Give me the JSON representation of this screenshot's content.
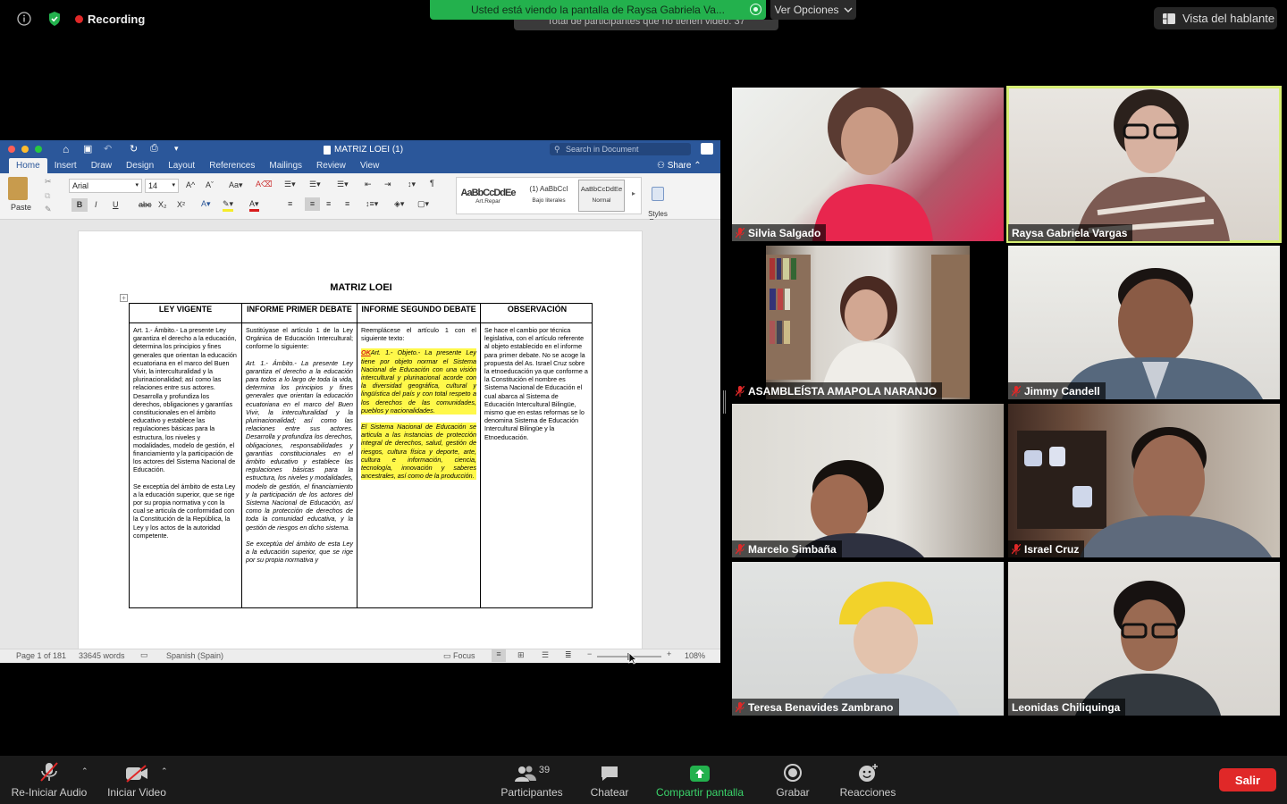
{
  "top": {
    "recording_label": "Recording",
    "share_banner": "Usted está viendo la pantalla de Raysa Gabriela Va...",
    "view_options": "Ver Opciones",
    "ghost_tip": "Total de participantes que no tienen video: 37",
    "speaker_view": "Vista del hablante"
  },
  "word": {
    "title": "MATRIZ LOEI (1)",
    "search_placeholder": "Search in Document",
    "share": "Share",
    "tabs": [
      "Home",
      "Insert",
      "Draw",
      "Design",
      "Layout",
      "References",
      "Mailings",
      "Review",
      "View"
    ],
    "font_name": "Arial",
    "font_size": "14",
    "paste": "Paste",
    "styles": [
      {
        "preview": "AaBbCcDdEe",
        "name": "Art.Repar"
      },
      {
        "preview": "(1) AaBbCcI",
        "name": "Bajo literales"
      },
      {
        "preview": "AaBbCcDdEe",
        "name": "Normal"
      }
    ],
    "styles_pane": "Styles\nPane",
    "status": {
      "page": "Page 1 of 181",
      "words": "33645 words",
      "language": "Spanish (Spain)",
      "focus": "Focus",
      "zoom": "108%"
    },
    "doc": {
      "heading": "MATRIZ LOEI",
      "columns": [
        "LEY VIGENTE",
        "INFORME PRIMER DEBATE",
        "INFORME SEGUNDO DEBATE",
        "OBSERVACIÓN"
      ],
      "col1": "Art. 1.- Ámbito.- La presente Ley garantiza el derecho a la educación, determina los principios y fines generales que orientan la educación ecuatoriana en el marco del Buen Vivir, la interculturalidad y la plurinacionalidad; así como las relaciones entre sus actores. Desarrolla y profundiza los derechos, obligaciones y garantías constitucionales en el ámbito educativo y establece las regulaciones básicas para la estructura, los niveles y modalidades, modelo de gestión, el financiamiento y la participación de los actores del Sistema Nacional de Educación.",
      "col1b": "Se exceptúa del ámbito de esta Ley a la educación superior, que se rige por su propia normativa y con la cual se articula de conformidad con la Constitución de la República, la Ley y los actos de la autoridad competente.",
      "col2a": "Sustitúyase el artículo 1 de la Ley Orgánica de Educación Intercultural; conforme lo siguiente:",
      "col2b": "Art. 1.- Ámbito.- La presente Ley garantiza el derecho a la educación para todos a lo largo de toda la vida, determina los principios y fines generales que orientan la educación ecuatoriana en el marco del Buen Vivir, la interculturalidad y la plurinacionalidad; así como las relaciones entre sus actores. Desarrolla y profundiza los derechos, obligaciones, responsabilidades y garantías constitucionales en el ámbito educativo y establece las regulaciones básicas para la estructura, los niveles y modalidades, modelo de gestión, el financiamiento y la participación de los actores del Sistema Nacional de Educación, así como la protección de derechos de toda la comunidad educativa, y la gestión de riesgos en dicho sistema.",
      "col2c": "Se exceptúa del ámbito de esta Ley a la educación superior, que se rige por su propia normativa y",
      "col3a": "Reemplácese el artículo 1 con el siguiente texto:",
      "col3_ok": "OK",
      "col3b": "Art. 1.- Objeto.- La presente Ley tiene por objeto normar el Sistema Nacional de Educación con una visión intercultural y plurinacional acorde con la diversidad geográfica, cultural y lingüística del país y con total respeto a los derechos de las comunidades, pueblos y nacionalidades.",
      "col3c": "El Sistema Nacional de Educación se articula a las instancias de protección integral de derechos, salud, gestión de riesgos, cultura física y deporte, arte, cultura e información, ciencia, tecnología, innovación y saberes ancestrales, así como de la producción.",
      "col4": "Se hace el cambio por técnica legislativa, con el artículo referente al objeto establecido en el informe para primer debate. No se acoge la propuesta del As. Israel Cruz sobre la etnoeducación ya que conforme a la Constitución el nombre es Sistema Nacional de Educación el cual abarca al Sistema de Educación Intercultural Bilingüe, mismo que en estas reformas se lo denomina  Sistema de Educación Intercultural Bilingüe y la Etnoeducación."
    }
  },
  "participants": [
    {
      "name": "Silvia Salgado",
      "muted": true
    },
    {
      "name": "Raysa Gabriela Vargas",
      "muted": false,
      "active": true
    },
    {
      "name": "ASAMBLEÍSTA AMAPOLA NARANJO",
      "muted": true
    },
    {
      "name": "Jimmy Candell",
      "muted": true
    },
    {
      "name": "Marcelo Simbaña",
      "muted": true
    },
    {
      "name": "Israel Cruz",
      "muted": true
    },
    {
      "name": "Teresa Benavides Zambrano",
      "muted": true
    },
    {
      "name": "Leonidas Chiliquinga",
      "muted": false
    }
  ],
  "bottom": {
    "audio": "Re-Iniciar Audio",
    "video": "Iniciar Video",
    "participants": "Participantes",
    "participant_count": "39",
    "chat": "Chatear",
    "share": "Compartir pantalla",
    "record": "Grabar",
    "reactions": "Reacciones",
    "leave": "Salir"
  },
  "colors": {
    "share_green": "#23b14d",
    "word_blue": "#2b579a",
    "leave_red": "#e02828",
    "active_speaker": "#d6ee74",
    "highlight": "#fff84a"
  }
}
